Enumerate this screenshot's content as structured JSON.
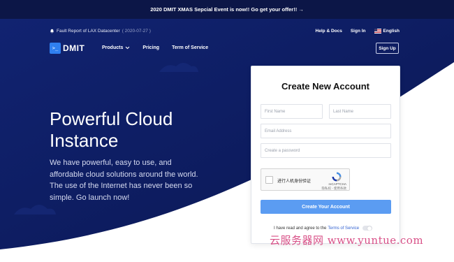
{
  "announcement": "2020 DMIT XMAS Sepcial Event is now!! Go get your offer!! →",
  "util_nav": {
    "notice_icon": "bell-icon",
    "notice": "Fault Report of LAX Datacenter",
    "notice_date": "( 2020-07-27 )",
    "help": "Help & Docs",
    "signin": "Sign In",
    "language_icon": "flag-icon",
    "language": "English"
  },
  "nav": {
    "logo_symbol": ">_",
    "logo_text": "DMIT",
    "products": "Products",
    "products_icon": "chevron-down-icon",
    "pricing": "Pricing",
    "terms": "Term of Service",
    "signup": "Sign Up"
  },
  "hero": {
    "title_line1": "Powerful Cloud",
    "title_line2": "Instance",
    "lead": "We have powerful, easy to use, and affordable cloud solutions around the world. The use of the Internet has never been so simple. Go launch now!"
  },
  "form": {
    "title": "Create New Account",
    "first_name_placeholder": "First Name",
    "last_name_placeholder": "Last Name",
    "email_placeholder": "Email Address",
    "password_placeholder": "Create a password",
    "captcha_label": "进行人机身份验证",
    "captcha_brand": "reCAPTCHA",
    "captcha_terms": "隐私权 - 使用条款",
    "submit": "Create Your Account",
    "agree_text": "I have read and agree to the",
    "agree_link": "Terms of Service"
  },
  "watermark": "云服务器网 www.yuntue.com",
  "colors": {
    "navy": "#0d1a5c",
    "topbar": "#0c1647",
    "accent": "#5b9cf2",
    "logo": "#2f7ff0",
    "watermark": "#d43c7a"
  }
}
